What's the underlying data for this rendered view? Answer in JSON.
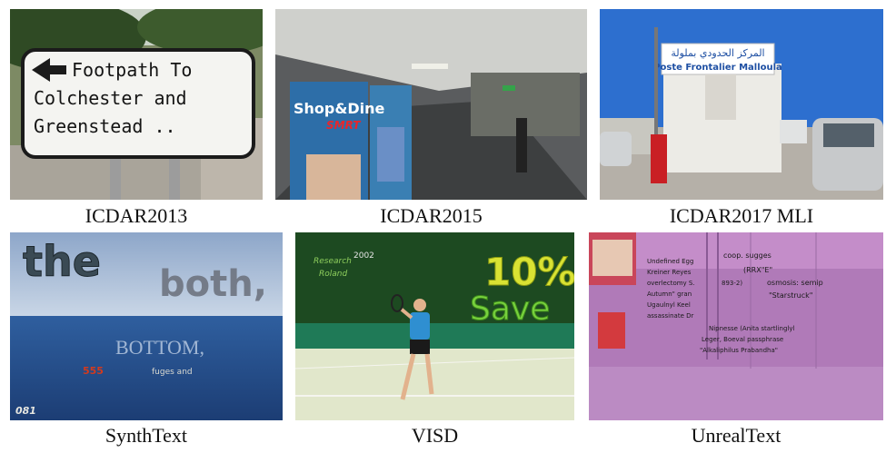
{
  "figure": {
    "panels": [
      {
        "caption": "ICDAR2013",
        "scene_text": [
          "Footpath To",
          "Colchester and",
          "Greenstead .."
        ]
      },
      {
        "caption": "ICDAR2015",
        "scene_text": [
          "Shop&Dine",
          "SMRT"
        ]
      },
      {
        "caption": "ICDAR2017 MLI",
        "scene_text": [
          "المركز الحدودي بملولة",
          "Poste Frontalier Malloula"
        ]
      },
      {
        "caption": "SynthText",
        "scene_text": [
          "the",
          "both,",
          "BOTTOM,",
          "555",
          "fuges and",
          "081"
        ]
      },
      {
        "caption": "VISD",
        "scene_text": [
          "Research",
          "2002",
          "Roland",
          "10%",
          "Save"
        ]
      },
      {
        "caption": "UnrealText",
        "scene_text": [
          "coop. sugges",
          "(RRX\"E\"",
          "Undefined Egg",
          "Kreiner Reyes",
          "overlectomy S.",
          "Autumn\" gran",
          "Ugaulnyl Keel",
          "assassinate Dr",
          "893-2)",
          "osmosis: semip",
          "\"Starstruck\"",
          "Nipnesse (Anita startlinglyl",
          "Leger, Boeval passphrase",
          "\"Alkaliphilus Prabandha\""
        ]
      }
    ]
  }
}
